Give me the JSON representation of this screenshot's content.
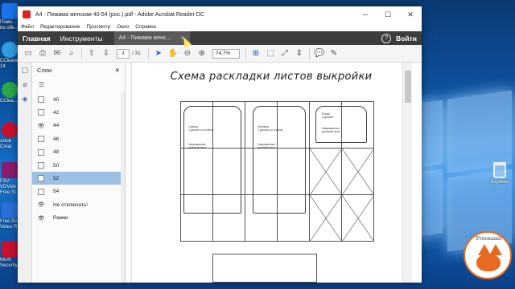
{
  "desktop": {
    "icons": [
      {
        "name": "Помо...\nпо обн...",
        "color": "#1a73e8"
      },
      {
        "name": "CCleaner\n14",
        "color": "#2f9ee0"
      },
      {
        "name": "CClea...",
        "color": "#2aa84a"
      },
      {
        "name": "Adob\nCreat",
        "color": "#c8102e"
      },
      {
        "name": "FSV\nVDVide\nFree St",
        "color": "#8a1c6f"
      },
      {
        "name": "Free Sc\nVideo R",
        "color": "#2b6fd6"
      },
      {
        "name": "McAf\nSecurity",
        "color": "#c8102e"
      }
    ],
    "recycle_bin": "Корзина",
    "fox_brand": "Freemanic"
  },
  "window": {
    "title": "A4 - Пижама женская 40-54 (рос.).pdf - Adobe Acrobat Reader DC",
    "controls": {
      "minimize": "─",
      "maximize": "☐",
      "close": "✕"
    }
  },
  "menu": [
    "Файл",
    "Редактирование",
    "Просмотр",
    "Окно",
    "Справка"
  ],
  "tabs": {
    "home": "Главная",
    "tools": "Инструменты",
    "document": "A4 - Пижама женс...",
    "close_doc": "×",
    "help": "?",
    "login": "Войти"
  },
  "toolbar": {
    "page_current": "1",
    "page_total": "/ 31",
    "zoom": "74,7%"
  },
  "layers_panel": {
    "title": "Слои",
    "close": "✕",
    "options_icon": "☰",
    "layers": [
      {
        "name": "40",
        "visible": false,
        "selected": false
      },
      {
        "name": "42",
        "visible": false,
        "selected": false
      },
      {
        "name": "44",
        "visible": true,
        "selected": false
      },
      {
        "name": "46",
        "visible": false,
        "selected": false
      },
      {
        "name": "48",
        "visible": false,
        "selected": false
      },
      {
        "name": "50",
        "visible": false,
        "selected": false
      },
      {
        "name": "52",
        "visible": false,
        "selected": true
      },
      {
        "name": "54",
        "visible": false,
        "selected": false
      },
      {
        "name": "Не отключать!",
        "visible": true,
        "selected": false
      },
      {
        "name": "Рамки",
        "visible": true,
        "selected": false
      }
    ]
  },
  "document": {
    "heading": "Схема раскладки листов выкройки",
    "notes": {
      "back": "Спинка\n1 деталь со сгибом",
      "front": "Полочка\n1 деталь со сгибом",
      "sleeve": "Рукав\n2 детали",
      "grain": "Направление\nдолевой нити"
    }
  }
}
